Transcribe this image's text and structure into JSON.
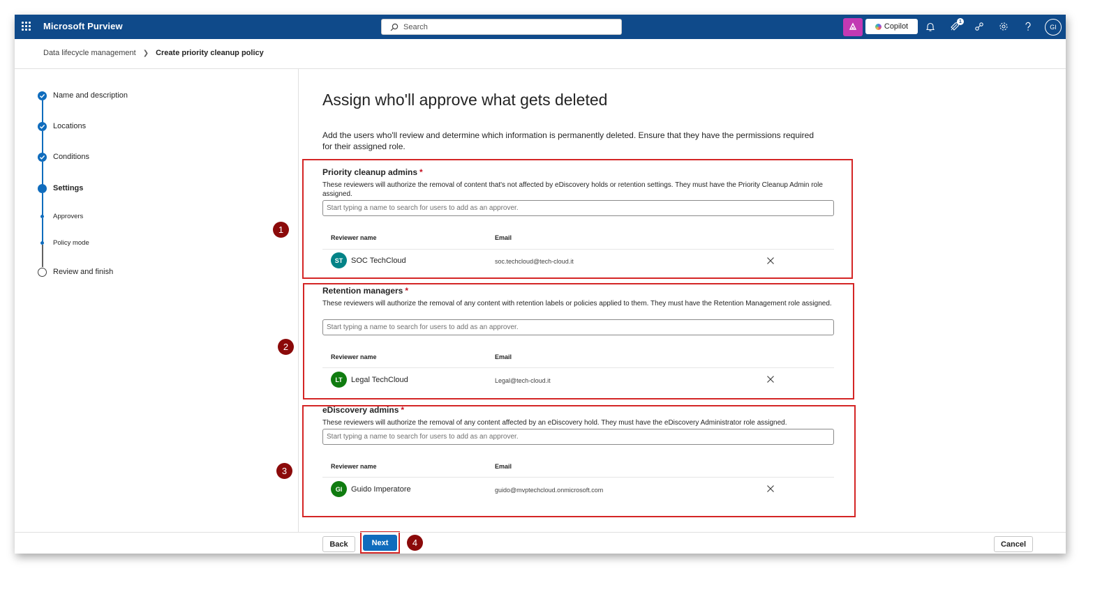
{
  "app": {
    "title": "Microsoft Purview"
  },
  "search": {
    "placeholder": "Search"
  },
  "topbar": {
    "copilot_label": "Copilot",
    "notification_count": "1",
    "avatar_initials": "GI"
  },
  "breadcrumb": {
    "parent": "Data lifecycle management",
    "current": "Create priority cleanup policy"
  },
  "steps": [
    {
      "label": "Name and description",
      "state": "done"
    },
    {
      "label": "Locations",
      "state": "done"
    },
    {
      "label": "Conditions",
      "state": "done"
    },
    {
      "label": "Settings",
      "state": "current"
    },
    {
      "label": "Approvers",
      "state": "substep"
    },
    {
      "label": "Policy mode",
      "state": "substep"
    },
    {
      "label": "Review and finish",
      "state": "todo"
    }
  ],
  "main": {
    "title": "Assign who'll approve what gets deleted",
    "description": "Add the users who'll review and determine which information is permanently deleted. Ensure that they have the permissions required for their assigned role."
  },
  "columns": {
    "name": "Reviewer name",
    "email": "Email"
  },
  "sections": [
    {
      "title": "Priority cleanup admins",
      "required": "*",
      "description": "These reviewers will authorize the removal of content that's not affected by eDiscovery holds or retention settings. They must have the Priority Cleanup Admin role assigned.",
      "placeholder": "Start typing a name to search for users to add as an approver.",
      "reviewer": {
        "initials": "ST",
        "name": "SOC TechCloud",
        "email": "soc.techcloud@tech-cloud.it",
        "color": "#038387"
      }
    },
    {
      "title": "Retention managers",
      "required": "*",
      "description": "These reviewers will authorize the removal of any content with retention labels or policies applied to them. They must have the Retention Management role assigned.",
      "placeholder": "Start typing a name to search for users to add as an approver.",
      "reviewer": {
        "initials": "LT",
        "name": "Legal TechCloud",
        "email": "Legal@tech-cloud.it",
        "color": "#107c10"
      }
    },
    {
      "title": "eDiscovery admins",
      "required": "*",
      "description": "These reviewers will authorize the removal of any content affected by an eDiscovery hold. They must have the eDiscovery Administrator role assigned.",
      "placeholder": "Start typing a name to search for users to add as an approver.",
      "reviewer": {
        "initials": "GI",
        "name": "Guido Imperatore",
        "email": "guido@mvptechcloud.onmicrosoft.com",
        "color": "#107c10"
      }
    }
  ],
  "markers": [
    "1",
    "2",
    "3",
    "4"
  ],
  "footer": {
    "back_label": "Back",
    "next_label": "Next",
    "cancel_label": "Cancel"
  },
  "colors": {
    "topbar": "#0f4a8a",
    "accent": "#0f6cbd",
    "annotation_red": "#d42525",
    "marker": "#8b0a0a",
    "required": "#c50f1f"
  }
}
